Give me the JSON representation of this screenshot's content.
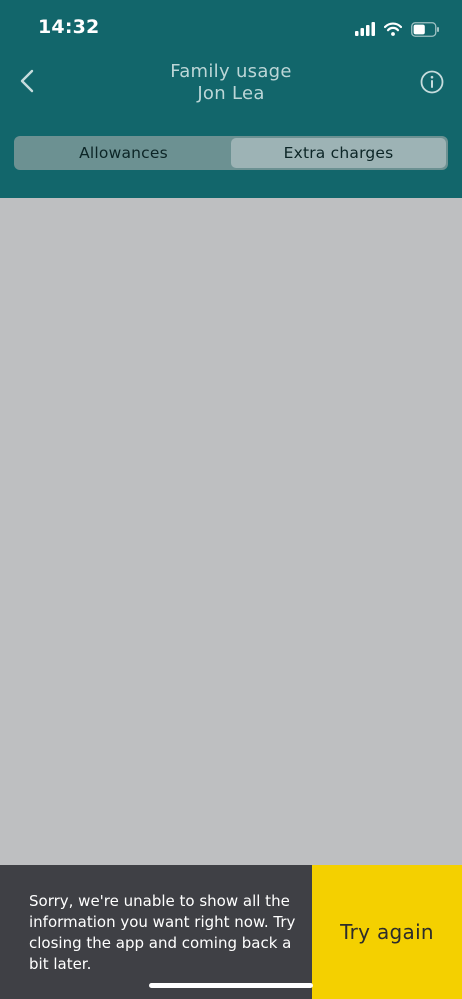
{
  "status_bar": {
    "time": "14:32",
    "icons": [
      "cellular-signal-icon",
      "wifi-icon",
      "battery-icon"
    ],
    "battery_level": 0.55
  },
  "header": {
    "title": "Family usage",
    "subtitle": "Jon Lea",
    "back_icon": "chevron-left-icon",
    "info_icon": "info-icon"
  },
  "tabs": [
    {
      "label": "Allowances",
      "active": false
    },
    {
      "label": "Extra charges",
      "active": true
    }
  ],
  "error": {
    "message": "Sorry, we're unable to show all the information you want right now. Try closing the app and coming back a bit later.",
    "retry_label": "Try again"
  },
  "colors": {
    "header_bg": "#12666b",
    "content_bg": "#bebfc1",
    "error_bg": "#3f4045",
    "retry_bg": "#f4d000"
  }
}
